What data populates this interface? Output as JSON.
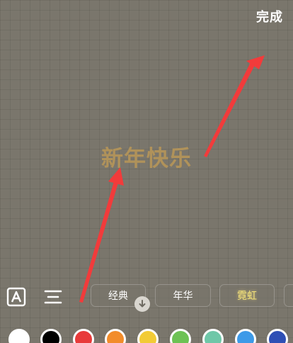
{
  "header": {
    "done_label": "完成"
  },
  "canvas": {
    "text": "新年快乐",
    "text_color": "#b0925a"
  },
  "toolbar": {
    "font_style_icon": "text-box-a-icon",
    "align_icon": "align-center-icon",
    "styles": [
      {
        "label": "经典"
      },
      {
        "label": "年华"
      },
      {
        "label": "霓虹"
      }
    ],
    "download_icon": "download-arrow-icon"
  },
  "colors": {
    "swatches": [
      "#ffffff",
      "#000000",
      "#e83a3a",
      "#f28c2a",
      "#f2cb36",
      "#6dc254",
      "#6fc7a8",
      "#3d9ae8",
      "#2e4fb5"
    ]
  },
  "annotations": {
    "arrow_color": "#f23b3b"
  }
}
